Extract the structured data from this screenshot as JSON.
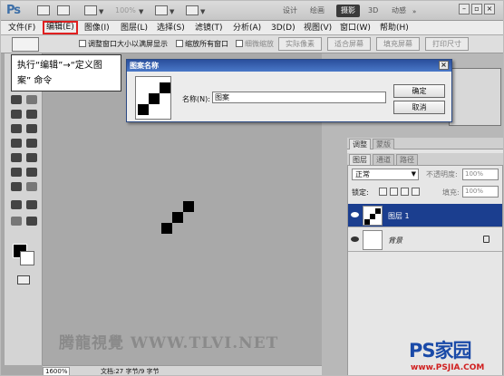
{
  "appbar": {
    "logo": "Ps",
    "zoom_value": "100%",
    "workspaces": [
      "设计",
      "绘画",
      "摄影",
      "3D",
      "动感"
    ],
    "active_workspace": "摄影"
  },
  "menubar": {
    "items": [
      "文件(F)",
      "编辑(E)",
      "图像(I)",
      "图层(L)",
      "选择(S)",
      "滤镜(T)",
      "分析(A)",
      "3D(D)",
      "视图(V)",
      "窗口(W)",
      "帮助(H)"
    ],
    "highlighted": "编辑(E)"
  },
  "options": {
    "resize_windows": "调整窗口大小以满屏显示",
    "zoom_all": "缩放所有窗口",
    "scrubby_zoom": "细微缩放",
    "actual_pixels": "实际像素",
    "fit_screen": "适合屏幕",
    "fill_screen": "填充屏幕",
    "print_size": "打印尺寸"
  },
  "callout": {
    "text": "执行“编辑”→“定义图案” 命令"
  },
  "dialog": {
    "title": "图案名称",
    "name_label": "名称(N):",
    "name_value": "图案",
    "ok_label": "确定",
    "cancel_label": "取消"
  },
  "canvas": {
    "watermark": "腾龍視覺 WWW.TLVI.NET"
  },
  "status": {
    "zoom": "1600%",
    "doc_info": "文档:27 字节/9 字节"
  },
  "panels": {
    "adjust_tabs": [
      "调整",
      "蒙版"
    ],
    "layer_tabs": [
      "图层",
      "通道",
      "路径"
    ],
    "blend_mode": "正常",
    "opacity_label": "不透明度:",
    "opacity_value": "100%",
    "lock_label": "锁定:",
    "fill_label": "填充:",
    "fill_value": "100%",
    "layers": [
      {
        "name": "图层 1",
        "selected": true
      },
      {
        "name": "背景",
        "selected": false
      }
    ]
  },
  "logo": {
    "main": "PS家园",
    "url": "www.PSJIA.COM"
  },
  "colors": {
    "highlight_box": "#e02020",
    "selected_layer": "#1b3e8f",
    "dialog_title": "#2a4f9c"
  }
}
